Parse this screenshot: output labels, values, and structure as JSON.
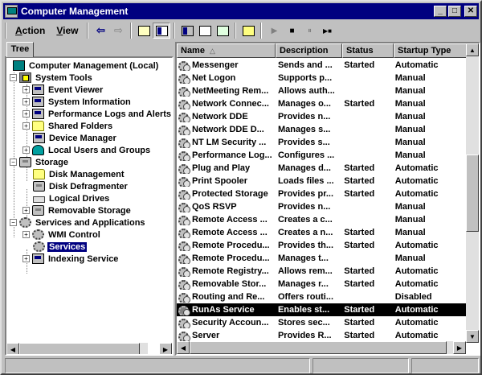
{
  "window": {
    "title": "Computer Management"
  },
  "menu": {
    "action_label": "Action",
    "action_ul": "A",
    "action_rest": "ction",
    "view_label": "View",
    "view_ul": "V",
    "view_rest": "iew"
  },
  "toolbar": {
    "back_icon": "⇦",
    "forward_icon": "⇨",
    "play_icon": "▶",
    "stop_icon": "■",
    "pause_icon": "⏸",
    "restart_icon": "▶■"
  },
  "tree": {
    "tab_label": "Tree",
    "items": [
      {
        "label": "Computer Management (Local)",
        "icon": "monitor-icon"
      },
      {
        "label": "System Tools",
        "icon": "tools-icon",
        "expander": "−"
      },
      {
        "label": "Event Viewer",
        "icon": "event-viewer-icon",
        "expander": "+"
      },
      {
        "label": "System Information",
        "icon": "system-info-icon",
        "expander": "+"
      },
      {
        "label": "Performance Logs and Alerts",
        "icon": "performance-icon",
        "expander": "+"
      },
      {
        "label": "Shared Folders",
        "icon": "folder-icon",
        "expander": "+"
      },
      {
        "label": "Device Manager",
        "icon": "device-manager-icon"
      },
      {
        "label": "Local Users and Groups",
        "icon": "users-icon",
        "expander": "+"
      },
      {
        "label": "Storage",
        "icon": "storage-icon",
        "expander": "−"
      },
      {
        "label": "Disk Management",
        "icon": "disk-management-icon"
      },
      {
        "label": "Disk Defragmenter",
        "icon": "defrag-icon"
      },
      {
        "label": "Logical Drives",
        "icon": "drive-icon"
      },
      {
        "label": "Removable Storage",
        "icon": "removable-storage-icon",
        "expander": "+"
      },
      {
        "label": "Services and Applications",
        "icon": "services-apps-icon",
        "expander": "−"
      },
      {
        "label": "WMI Control",
        "icon": "wmi-icon",
        "expander": "+"
      },
      {
        "label": "Services",
        "icon": "services-icon",
        "selected": true
      },
      {
        "label": "Indexing Service",
        "icon": "indexing-icon",
        "expander": "+"
      }
    ]
  },
  "list": {
    "columns": {
      "name": "Name",
      "sort_indicator": "△",
      "description": "Description",
      "status": "Status",
      "startup": "Startup Type"
    },
    "rows": [
      {
        "name": "Messenger",
        "description": "Sends and ...",
        "status": "Started",
        "startup": "Automatic"
      },
      {
        "name": "Net Logon",
        "description": "Supports p...",
        "status": "",
        "startup": "Manual"
      },
      {
        "name": "NetMeeting Rem...",
        "description": "Allows auth...",
        "status": "",
        "startup": "Manual"
      },
      {
        "name": "Network Connec...",
        "description": "Manages o...",
        "status": "Started",
        "startup": "Manual"
      },
      {
        "name": "Network DDE",
        "description": "Provides n...",
        "status": "",
        "startup": "Manual"
      },
      {
        "name": "Network DDE D...",
        "description": "Manages s...",
        "status": "",
        "startup": "Manual"
      },
      {
        "name": "NT LM Security ...",
        "description": "Provides s...",
        "status": "",
        "startup": "Manual"
      },
      {
        "name": "Performance Log...",
        "description": "Configures ...",
        "status": "",
        "startup": "Manual"
      },
      {
        "name": "Plug and Play",
        "description": "Manages d...",
        "status": "Started",
        "startup": "Automatic"
      },
      {
        "name": "Print Spooler",
        "description": "Loads files ...",
        "status": "Started",
        "startup": "Automatic"
      },
      {
        "name": "Protected Storage",
        "description": "Provides pr...",
        "status": "Started",
        "startup": "Automatic"
      },
      {
        "name": "QoS RSVP",
        "description": "Provides n...",
        "status": "",
        "startup": "Manual"
      },
      {
        "name": "Remote Access ...",
        "description": "Creates a c...",
        "status": "",
        "startup": "Manual"
      },
      {
        "name": "Remote Access ...",
        "description": "Creates a n...",
        "status": "Started",
        "startup": "Manual"
      },
      {
        "name": "Remote Procedu...",
        "description": "Provides th...",
        "status": "Started",
        "startup": "Automatic"
      },
      {
        "name": "Remote Procedu...",
        "description": "Manages t...",
        "status": "",
        "startup": "Manual"
      },
      {
        "name": "Remote Registry...",
        "description": "Allows rem...",
        "status": "Started",
        "startup": "Automatic"
      },
      {
        "name": "Removable Stor...",
        "description": "Manages r...",
        "status": "Started",
        "startup": "Automatic"
      },
      {
        "name": "Routing and Re...",
        "description": "Offers routi...",
        "status": "",
        "startup": "Disabled"
      },
      {
        "name": "RunAs Service",
        "description": "Enables st...",
        "status": "Started",
        "startup": "Automatic",
        "selected": true
      },
      {
        "name": "Security Accoun...",
        "description": "Stores sec...",
        "status": "Started",
        "startup": "Automatic"
      },
      {
        "name": "Server",
        "description": "Provides R...",
        "status": "Started",
        "startup": "Automatic"
      }
    ]
  }
}
